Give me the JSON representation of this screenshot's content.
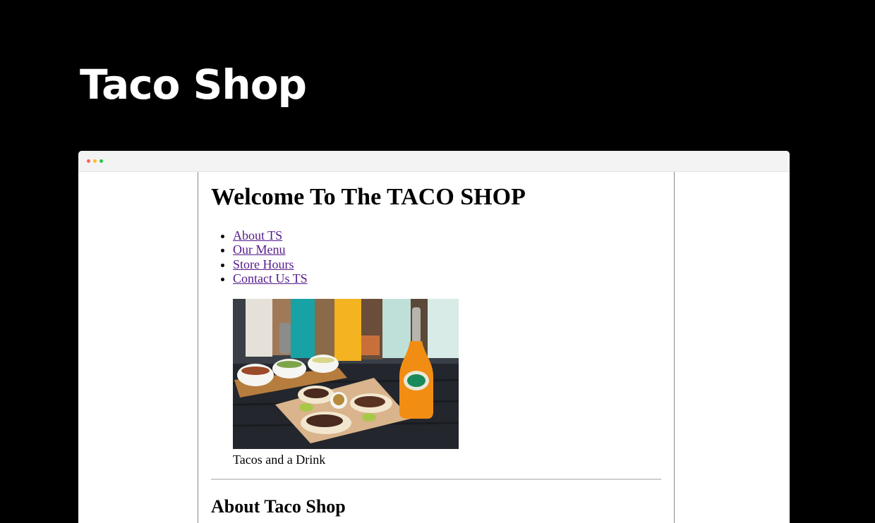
{
  "hero": {
    "title": "Taco Shop"
  },
  "browser": {
    "dot_colors": [
      "#ff5f57",
      "#febc2e",
      "#28c840"
    ]
  },
  "page": {
    "heading": "Welcome To The TACO SHOP",
    "nav": [
      {
        "label": "About TS"
      },
      {
        "label": "Our Menu"
      },
      {
        "label": "Store Hours"
      },
      {
        "label": "Contact Us TS"
      }
    ],
    "image_caption": "Tacos and a Drink",
    "section_heading": "About Taco Shop"
  },
  "colors": {
    "background": "#000000",
    "link_visited": "#551a8b"
  }
}
